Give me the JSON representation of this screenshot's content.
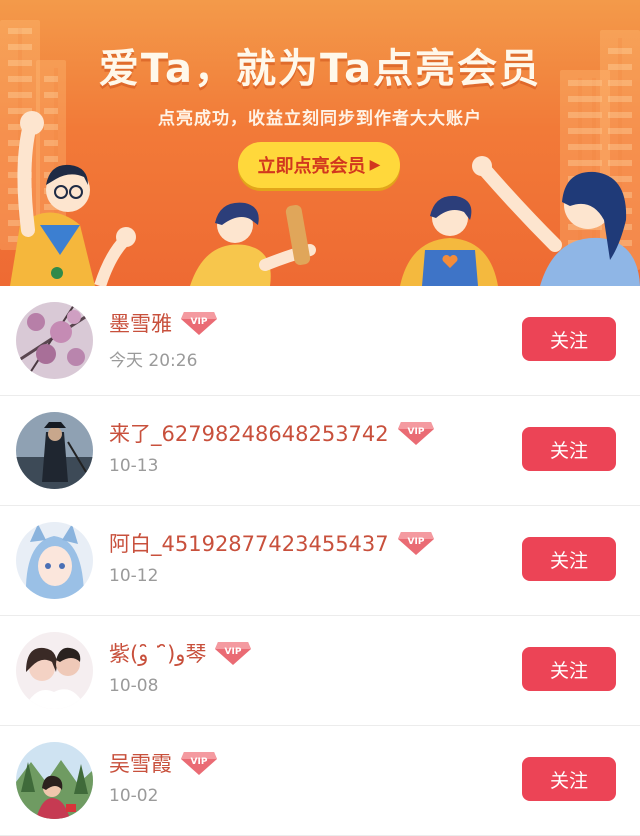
{
  "banner": {
    "headline": "爱Ta，就为Ta点亮会员",
    "subline": "点亮成功，收益立刻同步到作者大大账户",
    "cta_label": "立即点亮会员",
    "cta_arrow": "▶"
  },
  "colors": {
    "banner_top": "#f39a4a",
    "banner_bottom": "#ee6a33",
    "cta_bg": "#ffd83b",
    "name_text": "#c8503c",
    "follow_bg": "#ec4456",
    "vip_badge": "#e7606a"
  },
  "vip_label": "VIP",
  "users": [
    {
      "name": "墨雪雅",
      "date": "今天 20:26",
      "follow_label": "关注",
      "avatar": "blossom-avatar"
    },
    {
      "name": "来了_62798248648253742",
      "date": "10-13",
      "follow_label": "关注",
      "avatar": "pirate-avatar"
    },
    {
      "name": "阿白_45192877423455437",
      "date": "10-12",
      "follow_label": "关注",
      "avatar": "anime-avatar"
    },
    {
      "name": "紫(و ̑̑ᐝ ̑̑)و琴",
      "date": "10-08",
      "follow_label": "关注",
      "avatar": "couple-avatar"
    },
    {
      "name": "吴雪霞",
      "date": "10-02",
      "follow_label": "关注",
      "avatar": "outdoor-avatar"
    }
  ]
}
